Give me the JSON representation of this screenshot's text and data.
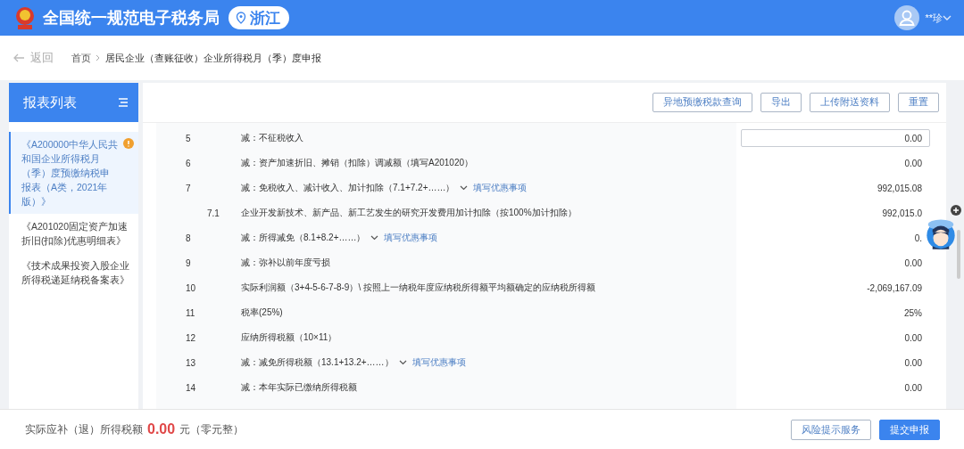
{
  "header": {
    "title": "全国统一规范电子税务局",
    "region": "浙江",
    "user": "**珍"
  },
  "breadcrumb": {
    "back": "返回",
    "items": [
      "首页",
      "居民企业（查账征收）企业所得税月（季）度申报"
    ]
  },
  "sidebar": {
    "title": "报表列表",
    "items": [
      {
        "label": "《A200000中华人民共和国企业所得税月（季）度预缴纳税申报表（A类，2021年版）》",
        "selected": true,
        "alert": true
      },
      {
        "label": "《A201020固定资产加速折旧(扣除)优惠明细表》",
        "selected": false,
        "alert": false
      },
      {
        "label": "《技术成果投资入股企业所得税递延纳税备案表》",
        "selected": false,
        "alert": false
      }
    ]
  },
  "toolbar": {
    "buttons": [
      "异地预缴税款查询",
      "导出",
      "上传附送资料",
      "重置"
    ]
  },
  "table": {
    "rows": [
      {
        "number": "5",
        "label": "减：不征税收入",
        "kind": "input",
        "value": "0.00"
      },
      {
        "number": "6",
        "label": "减：资产加速折旧、摊销（扣除）调减额（填写A201020）",
        "kind": "value",
        "value": "0.00"
      },
      {
        "number": "7",
        "label": "减：免税收入、减计收入、加计扣除（7.1+7.2+……）",
        "kind": "value",
        "value": "992,015.08",
        "link": "填写优惠事项"
      },
      {
        "number": "7.1",
        "label": "企业开发新技术、新产品、新工艺发生的研究开发费用加计扣除（按100%加计扣除）",
        "kind": "sub",
        "value": "992,015.0"
      },
      {
        "number": "8",
        "label": "减：所得减免（8.1+8.2+……）",
        "kind": "value",
        "value": "0.",
        "link": "填写优惠事项"
      },
      {
        "number": "9",
        "label": "减：弥补以前年度亏损",
        "kind": "value",
        "value": "0.00"
      },
      {
        "number": "10",
        "label": "实际利润额（3+4-5-6-7-8-9）\\ 按照上一纳税年度应纳税所得额平均额确定的应纳税所得额",
        "kind": "value",
        "value": "-2,069,167.09"
      },
      {
        "number": "11",
        "label": "税率(25%)",
        "kind": "value",
        "value": "25%"
      },
      {
        "number": "12",
        "label": "应纳所得税额（10×11）",
        "kind": "value",
        "value": "0.00"
      },
      {
        "number": "13",
        "label": "减：减免所得税额（13.1+13.2+……）",
        "kind": "value",
        "value": "0.00",
        "link": "填写优惠事项"
      },
      {
        "number": "14",
        "label": "减：本年实际已缴纳所得税额",
        "kind": "value",
        "value": "0.00"
      }
    ]
  },
  "footer": {
    "label": "实际应补（退）所得税额",
    "amount": "0.00",
    "unit": "元（零元整）",
    "buttons": [
      {
        "label": "风险提示服务",
        "kind": "outline"
      },
      {
        "label": "提交申报",
        "kind": "primary"
      }
    ]
  }
}
